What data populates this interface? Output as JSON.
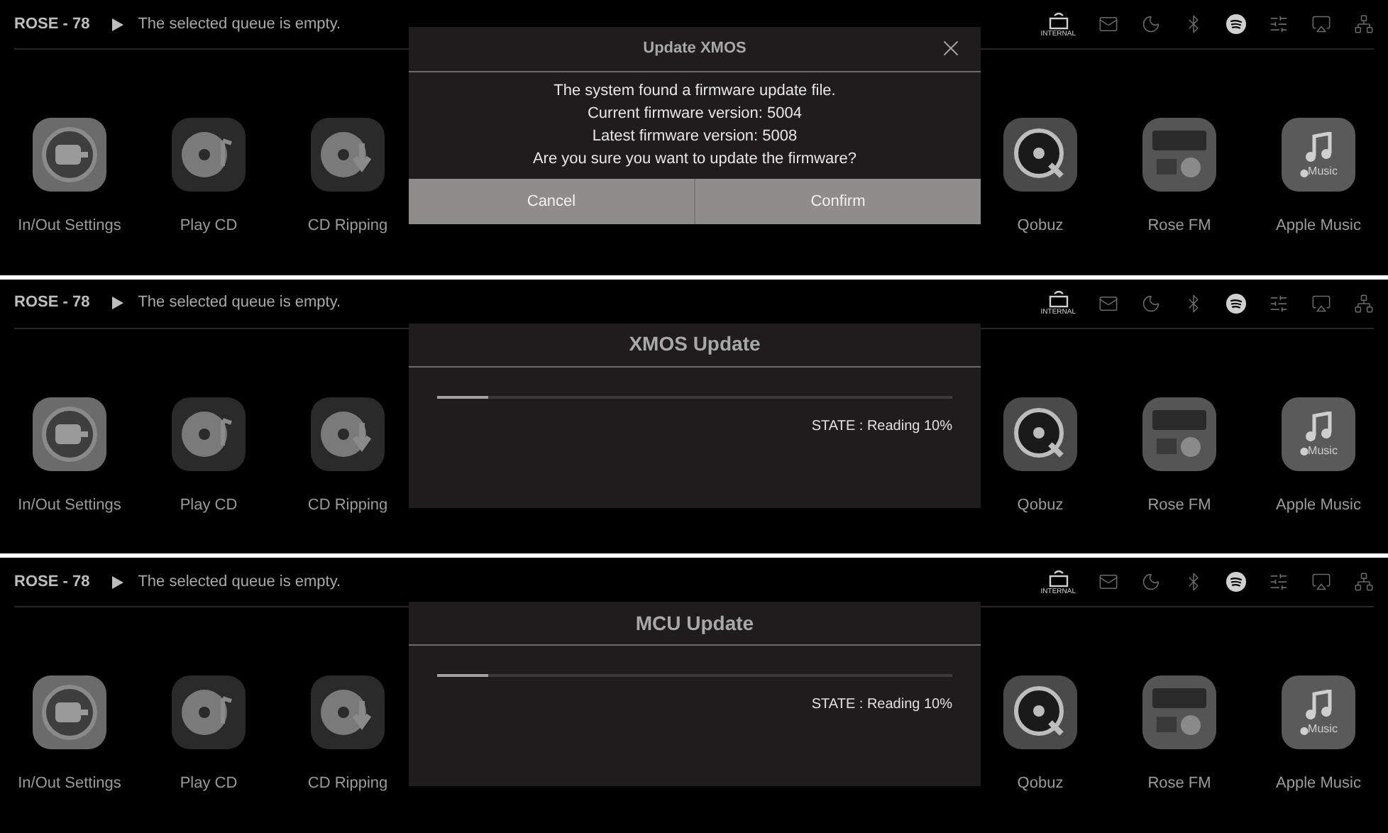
{
  "screens": [
    {
      "top_bar": {
        "device": "ROSE - 78",
        "queue_status": "The selected queue is empty."
      },
      "status_icons": [
        {
          "kind": "internal",
          "label": "INTERNAL",
          "active": true
        },
        {
          "kind": "mail",
          "active": false
        },
        {
          "kind": "timer",
          "active": false
        },
        {
          "kind": "bluetooth",
          "active": false
        },
        {
          "kind": "spotify",
          "active": true
        },
        {
          "kind": "sliders",
          "active": false
        },
        {
          "kind": "airplay",
          "active": false
        },
        {
          "kind": "network",
          "active": false
        }
      ],
      "apps": [
        {
          "kind": "settings",
          "label": "In/Out Settings"
        },
        {
          "kind": "cd",
          "label": "Play CD"
        },
        {
          "kind": "rip",
          "label": "CD Ripping"
        },
        {
          "kind": "qobuz",
          "label": "Qobuz"
        },
        {
          "kind": "radio",
          "label": "Rose FM"
        },
        {
          "kind": "music",
          "label": "Apple Music",
          "badge": "Music"
        }
      ],
      "dialog": {
        "kind": "confirm",
        "title": "Update XMOS",
        "lines": [
          "The system found a firmware update file.",
          "Current firmware version: 5004",
          "Latest firmware version: 5008",
          "Are you sure you want to update the firmware?"
        ],
        "buttons": [
          "Cancel",
          "Confirm"
        ]
      }
    },
    {
      "top_bar": {
        "device": "ROSE - 78",
        "queue_status": "The selected queue is empty."
      },
      "status_icons": [
        {
          "kind": "internal",
          "label": "INTERNAL",
          "active": true
        },
        {
          "kind": "mail",
          "active": false
        },
        {
          "kind": "timer",
          "active": false
        },
        {
          "kind": "bluetooth",
          "active": false
        },
        {
          "kind": "spotify",
          "active": true
        },
        {
          "kind": "sliders",
          "active": false
        },
        {
          "kind": "airplay",
          "active": false
        },
        {
          "kind": "network",
          "active": false
        }
      ],
      "apps": [
        {
          "kind": "settings",
          "label": "In/Out Settings"
        },
        {
          "kind": "cd",
          "label": "Play CD"
        },
        {
          "kind": "rip",
          "label": "CD Ripping"
        },
        {
          "kind": "qobuz",
          "label": "Qobuz"
        },
        {
          "kind": "radio",
          "label": "Rose FM"
        },
        {
          "kind": "music",
          "label": "Apple Music",
          "badge": "Music"
        }
      ],
      "dialog": {
        "kind": "progress",
        "title": "XMOS Update",
        "level": 0.1,
        "state": "STATE : Reading 10%"
      }
    },
    {
      "top_bar": {
        "device": "ROSE - 78",
        "queue_status": "The selected queue is empty."
      },
      "status_icons": [
        {
          "kind": "internal",
          "label": "INTERNAL",
          "active": true
        },
        {
          "kind": "mail",
          "active": false
        },
        {
          "kind": "timer",
          "active": false
        },
        {
          "kind": "bluetooth",
          "active": false
        },
        {
          "kind": "spotify",
          "active": true
        },
        {
          "kind": "sliders",
          "active": false
        },
        {
          "kind": "airplay",
          "active": false
        },
        {
          "kind": "network",
          "active": false
        }
      ],
      "apps": [
        {
          "kind": "settings",
          "label": "In/Out Settings"
        },
        {
          "kind": "cd",
          "label": "Play CD"
        },
        {
          "kind": "rip",
          "label": "CD Ripping"
        },
        {
          "kind": "qobuz",
          "label": "Qobuz"
        },
        {
          "kind": "radio",
          "label": "Rose FM"
        },
        {
          "kind": "music",
          "label": "Apple Music",
          "badge": "Music"
        }
      ],
      "dialog": {
        "kind": "progress",
        "title": "MCU Update",
        "level": 0.1,
        "state": "STATE : Reading 10%"
      }
    }
  ]
}
